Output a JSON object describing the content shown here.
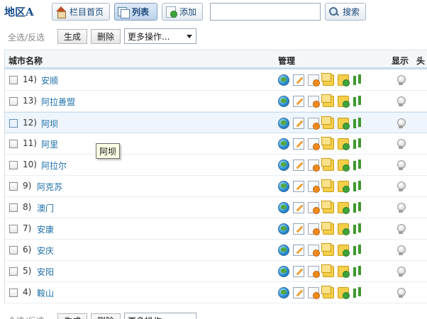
{
  "header": {
    "title": "地区A",
    "buttons": [
      {
        "label": "栏目首页",
        "icon": "home-icon"
      },
      {
        "label": "列表",
        "icon": "list-icon"
      },
      {
        "label": "添加",
        "icon": "add-page-icon"
      }
    ],
    "search": {
      "value": "",
      "placeholder": "",
      "button_label": "搜索"
    }
  },
  "actions": {
    "select_toggle": "全选/反选",
    "generate_label": "生成",
    "delete_label": "删除",
    "more_actions": "更多操作..."
  },
  "table": {
    "columns": {
      "name": "城市名称",
      "manage": "管理",
      "display": "显示",
      "head": "头"
    },
    "rows": [
      {
        "num": "14)",
        "name": "安顺"
      },
      {
        "num": "13)",
        "name": "阿拉善盟"
      },
      {
        "num": "12)",
        "name": "阿坝"
      },
      {
        "num": "11)",
        "name": "阿里"
      },
      {
        "num": "10)",
        "name": "阿拉尔"
      },
      {
        "num": "9)",
        "name": "阿克苏"
      },
      {
        "num": "8)",
        "name": "澳门"
      },
      {
        "num": "7)",
        "name": "安康"
      },
      {
        "num": "6)",
        "name": "安庆"
      },
      {
        "num": "5)",
        "name": "安阳"
      },
      {
        "num": "4)",
        "name": "鞍山"
      }
    ]
  },
  "tooltip": "阿坝",
  "colors": {
    "link": "#1d6fa8",
    "title": "#1a4f8b",
    "header_underline": "#c7dcee",
    "row_hover": "#eef5fc"
  }
}
